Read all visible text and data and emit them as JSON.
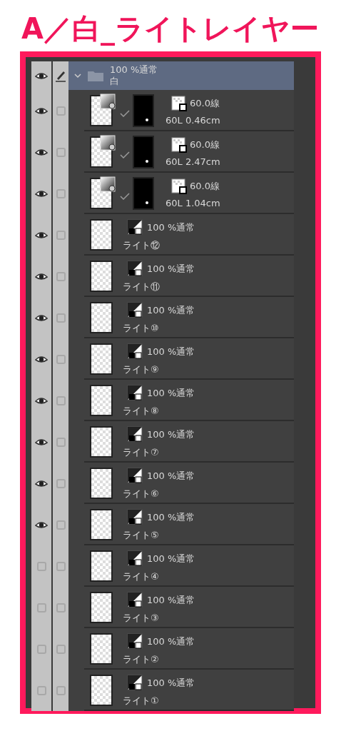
{
  "header": {
    "title": "A／白_ライトレイヤー"
  },
  "folder": {
    "visible": true,
    "editing": true,
    "expanded": true,
    "mode": "100 %通常",
    "name": "白",
    "selected": true
  },
  "layers": [
    {
      "kind": "correction",
      "visible": true,
      "checked": false,
      "mode": "60.0線",
      "name": "60L 0.46cm"
    },
    {
      "kind": "correction",
      "visible": true,
      "checked": false,
      "mode": "60.0線",
      "name": "60L 2.47cm"
    },
    {
      "kind": "correction",
      "visible": true,
      "checked": false,
      "mode": "60.0線",
      "name": "60L 1.04cm"
    },
    {
      "kind": "raster",
      "visible": true,
      "checked": false,
      "mode": "100 %通常",
      "name": "ライト⑫"
    },
    {
      "kind": "raster",
      "visible": true,
      "checked": false,
      "mode": "100 %通常",
      "name": "ライト⑪"
    },
    {
      "kind": "raster",
      "visible": true,
      "checked": false,
      "mode": "100 %通常",
      "name": "ライト⑩"
    },
    {
      "kind": "raster",
      "visible": true,
      "checked": false,
      "mode": "100 %通常",
      "name": "ライト⑨"
    },
    {
      "kind": "raster",
      "visible": true,
      "checked": false,
      "mode": "100 %通常",
      "name": "ライト⑧"
    },
    {
      "kind": "raster",
      "visible": true,
      "checked": false,
      "mode": "100 %通常",
      "name": "ライト⑦"
    },
    {
      "kind": "raster",
      "visible": true,
      "checked": false,
      "mode": "100 %通常",
      "name": "ライト⑥"
    },
    {
      "kind": "raster",
      "visible": true,
      "checked": false,
      "mode": "100 %通常",
      "name": "ライト⑤"
    },
    {
      "kind": "raster",
      "visible": false,
      "checked": false,
      "mode": "100 %通常",
      "name": "ライト④"
    },
    {
      "kind": "raster",
      "visible": false,
      "checked": false,
      "mode": "100 %通常",
      "name": "ライト③"
    },
    {
      "kind": "raster",
      "visible": false,
      "checked": false,
      "mode": "100 %通常",
      "name": "ライト②"
    },
    {
      "kind": "raster",
      "visible": false,
      "checked": false,
      "mode": "100 %通常",
      "name": "ライト①"
    }
  ]
}
